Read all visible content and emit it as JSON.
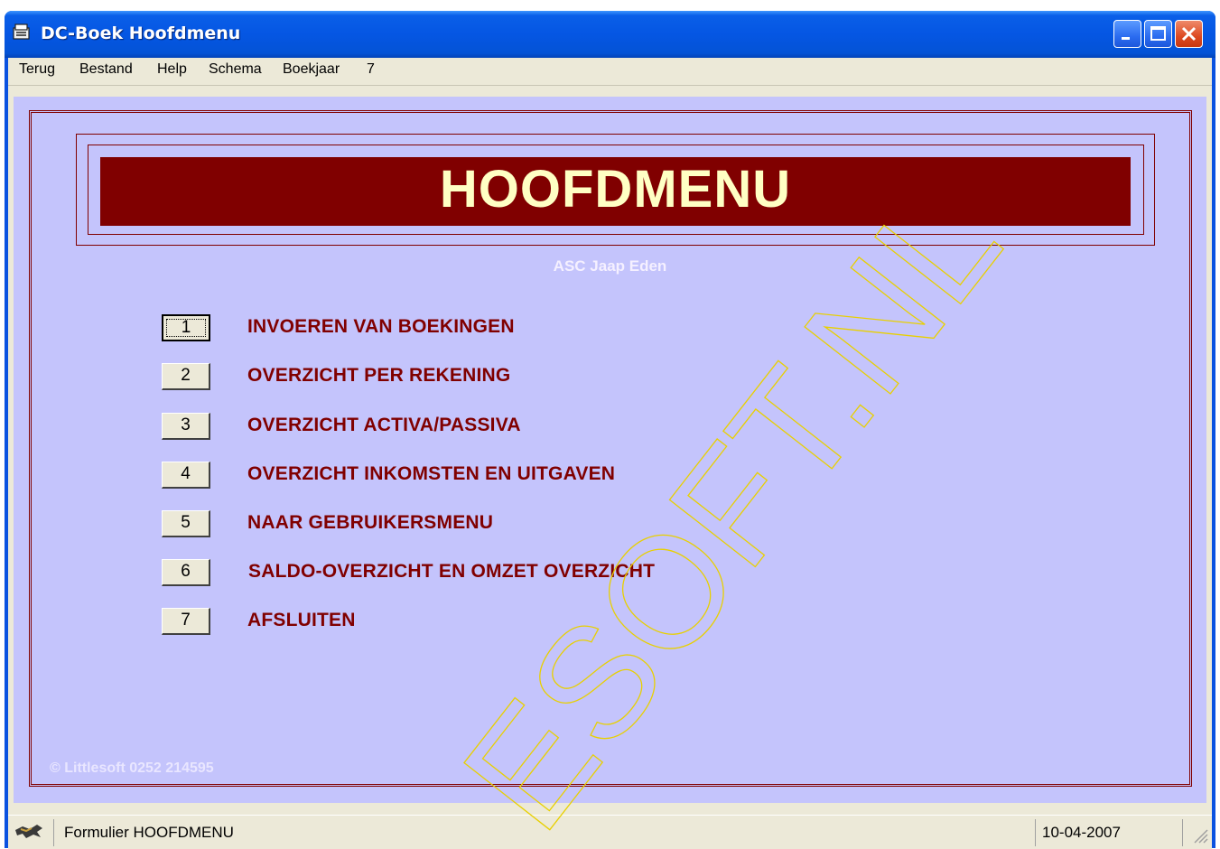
{
  "window": {
    "title": "DC-Boek Hoofdmenu"
  },
  "menubar": {
    "items": [
      "Terug",
      "Bestand",
      "Help",
      "Schema",
      "Boekjaar",
      "7"
    ]
  },
  "form": {
    "banner_title": "HOOFDMENU",
    "organization": "ASC Jaap Eden",
    "menu_items": [
      {
        "key": "1",
        "label": "INVOEREN VAN BOEKINGEN",
        "focused": true
      },
      {
        "key": "2",
        "label": "OVERZICHT PER REKENING"
      },
      {
        "key": "3",
        "label": "OVERZICHT ACTIVA/PASSIVA"
      },
      {
        "key": "4",
        "label": "OVERZICHT INKOMSTEN EN UITGAVEN"
      },
      {
        "key": "5",
        "label": "NAAR GEBRUIKERSMENU"
      },
      {
        "key": "6",
        "label": "SALDO-OVERZICHT EN OMZET OVERZICHT"
      },
      {
        "key": "7",
        "label": "AFSLUITEN"
      }
    ],
    "copyright": "© Littlesoft 0252 214595"
  },
  "statusbar": {
    "text": "Formulier HOOFDMENU",
    "date": "10-04-2007"
  },
  "watermark": {
    "text": "ESOFT.NL"
  },
  "colors": {
    "form_background": "#c4c4fc",
    "banner": "#800000",
    "banner_text": "#ffffc4",
    "label_text": "#800000",
    "titlebar": "#0556e3"
  }
}
